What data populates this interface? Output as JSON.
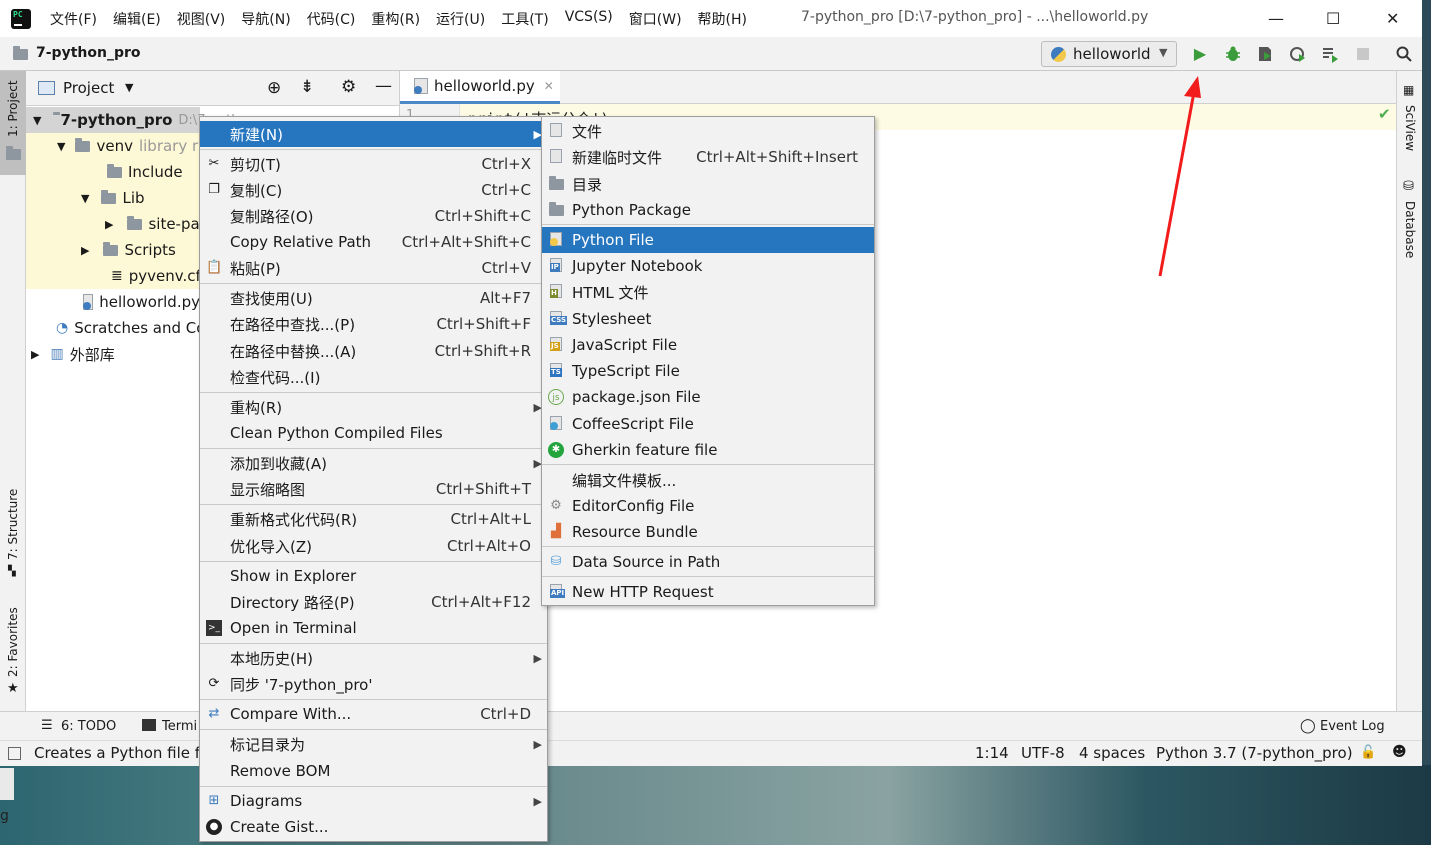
{
  "window": {
    "menus": [
      "文件(F)",
      "编辑(E)",
      "视图(V)",
      "导航(N)",
      "代码(C)",
      "重构(R)",
      "运行(U)",
      "工具(T)",
      "VCS(S)",
      "窗口(W)",
      "帮助(H)"
    ],
    "title": "7-python_pro [D:\\7-python_pro] - ...\\helloworld.py",
    "minimize": "—",
    "maximize": "☐",
    "close": "✕"
  },
  "navbar": {
    "project": "7-python_pro",
    "run_config": "helloworld"
  },
  "left_tabs": {
    "project": "1: Project",
    "structure": "7: Structure",
    "favorites": "2: Favorites"
  },
  "right_tabs": {
    "sciview": "SciView",
    "database": "Database"
  },
  "project_panel": {
    "header": "Project",
    "tree": [
      {
        "label": "7-python_pro",
        "hint": "D:\\7-python_pro",
        "level": 0
      },
      {
        "label": "venv",
        "hint": "library r",
        "level": 1
      },
      {
        "label": "Include",
        "level": 2
      },
      {
        "label": "Lib",
        "level": 2
      },
      {
        "label": "site-pa",
        "level": 3
      },
      {
        "label": "Scripts",
        "level": 2
      },
      {
        "label": "pyvenv.cfg",
        "level": 2
      },
      {
        "label": "helloworld.py",
        "level": 1
      },
      {
        "label": "Scratches and Co",
        "level": 0
      },
      {
        "label": "外部库",
        "level": 0
      }
    ]
  },
  "editor": {
    "tab": "helloworld.py",
    "line_number": "1",
    "code": "print('志远公众')"
  },
  "context_menu": {
    "items": [
      {
        "label": "新建(N)",
        "shortcut": "",
        "submenu": true
      },
      {
        "label": "剪切(T)",
        "shortcut": "Ctrl+X"
      },
      {
        "label": "复制(C)",
        "shortcut": "Ctrl+C"
      },
      {
        "label": "复制路径(O)",
        "shortcut": "Ctrl+Shift+C"
      },
      {
        "label": "Copy Relative Path",
        "shortcut": "Ctrl+Alt+Shift+C"
      },
      {
        "label": "粘贴(P)",
        "shortcut": "Ctrl+V"
      },
      {
        "label": "查找使用(U)",
        "shortcut": "Alt+F7"
      },
      {
        "label": "在路径中查找...(P)",
        "shortcut": "Ctrl+Shift+F"
      },
      {
        "label": "在路径中替换...(A)",
        "shortcut": "Ctrl+Shift+R"
      },
      {
        "label": "检查代码...(I)",
        "shortcut": ""
      },
      {
        "label": "重构(R)",
        "shortcut": "",
        "submenu": true
      },
      {
        "label": "Clean Python Compiled Files",
        "shortcut": ""
      },
      {
        "label": "添加到收藏(A)",
        "shortcut": "",
        "submenu": true
      },
      {
        "label": "显示缩略图",
        "shortcut": "Ctrl+Shift+T"
      },
      {
        "label": "重新格式化代码(R)",
        "shortcut": "Ctrl+Alt+L"
      },
      {
        "label": "优化导入(Z)",
        "shortcut": "Ctrl+Alt+O"
      },
      {
        "label": "Show in Explorer",
        "shortcut": ""
      },
      {
        "label": "Directory 路径(P)",
        "shortcut": "Ctrl+Alt+F12"
      },
      {
        "label": "Open in Terminal",
        "shortcut": ""
      },
      {
        "label": "本地历史(H)",
        "shortcut": "",
        "submenu": true
      },
      {
        "label": "同步 '7-python_pro'",
        "shortcut": ""
      },
      {
        "label": "Compare With...",
        "shortcut": "Ctrl+D"
      },
      {
        "label": "标记目录为",
        "shortcut": "",
        "submenu": true
      },
      {
        "label": "Remove BOM",
        "shortcut": ""
      },
      {
        "label": "Diagrams",
        "shortcut": "",
        "submenu": true
      },
      {
        "label": "Create Gist...",
        "shortcut": ""
      }
    ]
  },
  "submenu": {
    "items": [
      {
        "label": "文件",
        "shortcut": ""
      },
      {
        "label": "新建临时文件",
        "shortcut": "Ctrl+Alt+Shift+Insert"
      },
      {
        "label": "目录",
        "shortcut": ""
      },
      {
        "label": "Python Package",
        "shortcut": ""
      },
      {
        "label": "Python File",
        "shortcut": ""
      },
      {
        "label": "Jupyter Notebook",
        "shortcut": ""
      },
      {
        "label": "HTML 文件",
        "shortcut": ""
      },
      {
        "label": "Stylesheet",
        "shortcut": ""
      },
      {
        "label": "JavaScript File",
        "shortcut": ""
      },
      {
        "label": "TypeScript File",
        "shortcut": ""
      },
      {
        "label": "package.json File",
        "shortcut": ""
      },
      {
        "label": "CoffeeScript File",
        "shortcut": ""
      },
      {
        "label": "Gherkin feature file",
        "shortcut": ""
      },
      {
        "label": "编辑文件模板...",
        "shortcut": ""
      },
      {
        "label": "EditorConfig File",
        "shortcut": ""
      },
      {
        "label": "Resource Bundle",
        "shortcut": ""
      },
      {
        "label": "Data Source in Path",
        "shortcut": ""
      },
      {
        "label": "New HTTP Request",
        "shortcut": ""
      }
    ]
  },
  "bottom_tools": {
    "todo": "6: TODO",
    "terminal": "Termi",
    "event_log": "Event Log"
  },
  "status": {
    "message": "Creates a Python file fr",
    "position": "1:14",
    "encoding": "UTF-8",
    "indent": "4 spaces",
    "interpreter": "Python 3.7 (7-python_pro)"
  },
  "desktop": {
    "char": "g"
  },
  "colors": {
    "selection": "#2675bf",
    "run_green": "#3a9c3a",
    "annotation_arrow": "#f21c1c"
  }
}
